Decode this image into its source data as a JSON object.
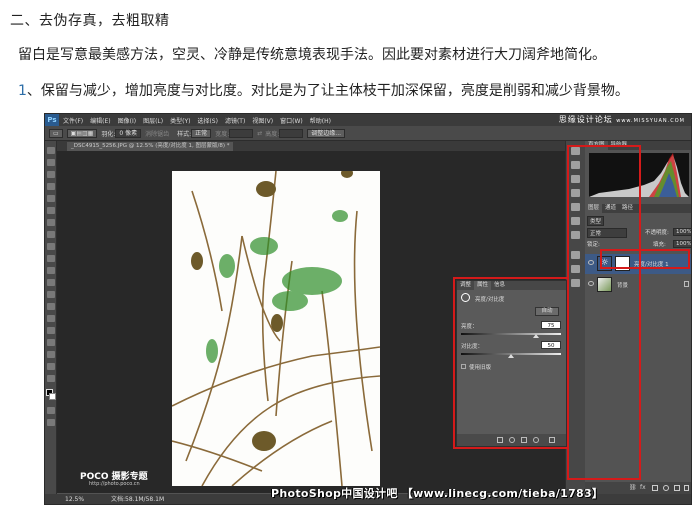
{
  "article": {
    "heading": "二、去伪存真，去粗取精",
    "paragraph": "留白是写意最美感方法，空灵、冷静是传统意境表现手法。因此要对素材进行大刀阔斧地简化。",
    "point_number": "1",
    "point_text": "、保留与减少，增加亮度与对比度。对比是为了让主体枝干加深保留，亮度是削弱和减少背景物。"
  },
  "photoshop": {
    "logo": "Ps",
    "menu": [
      "文件(F)",
      "编辑(E)",
      "图像(I)",
      "图层(L)",
      "类型(Y)",
      "选择(S)",
      "滤镜(T)",
      "视图(V)",
      "窗口(W)",
      "帮助(H)"
    ],
    "forum_logo": "思缘设计论坛",
    "forum_url": "www.MISSYUAN.COM",
    "options": {
      "feather_label": "羽化:",
      "feather_value": "0 像素",
      "antialias": "消除锯齿",
      "style_label": "样式:",
      "style_value": "正常",
      "width_label": "宽度:",
      "height_label": "高度:",
      "refine_edge": "调整边缘..."
    },
    "doc_tab": "_DSC4915_5256.JPG @ 12.5% (亮度/对比度 1, 图层蒙版/8) *",
    "status": {
      "zoom": "12.5%",
      "doc_size": "文档:58.1M/58.1M"
    },
    "photo_watermark": {
      "brand": "POCO 摄影专题",
      "url": "http://photo.poco.cn"
    },
    "bottom_watermark": "PhotoShop中国设计吧 【www.linecg.com/tieba/1783】",
    "properties": {
      "tabs": [
        "调整",
        "属性",
        "信息"
      ],
      "active_tab": "属性",
      "title": "亮度/对比度",
      "auto": "自动",
      "brightness_label": "亮度：",
      "brightness_value": "75",
      "brightness_fraction": 0.75,
      "contrast_label": "对比度：",
      "contrast_value": "50",
      "contrast_fraction": 0.5,
      "legacy": "使用旧版"
    },
    "right_panel": {
      "top_tabs": [
        "直方图",
        "导航器"
      ],
      "layer_tabs": [
        "图层",
        "通道",
        "路径"
      ],
      "kind": "类型",
      "blend": "正常",
      "opacity_label": "不透明度:",
      "opacity_value": "100%",
      "lock_label": "锁定:",
      "fill_label": "填充:",
      "fill_value": "100%",
      "layers": [
        {
          "name": "亮度/对比度 1",
          "active": true
        },
        {
          "name": "背景",
          "active": false
        }
      ]
    },
    "colors": {
      "highlight_box": "#d41a1a",
      "active_layer": "#3d5a86",
      "ps_logo": "#2a5b8f"
    }
  }
}
